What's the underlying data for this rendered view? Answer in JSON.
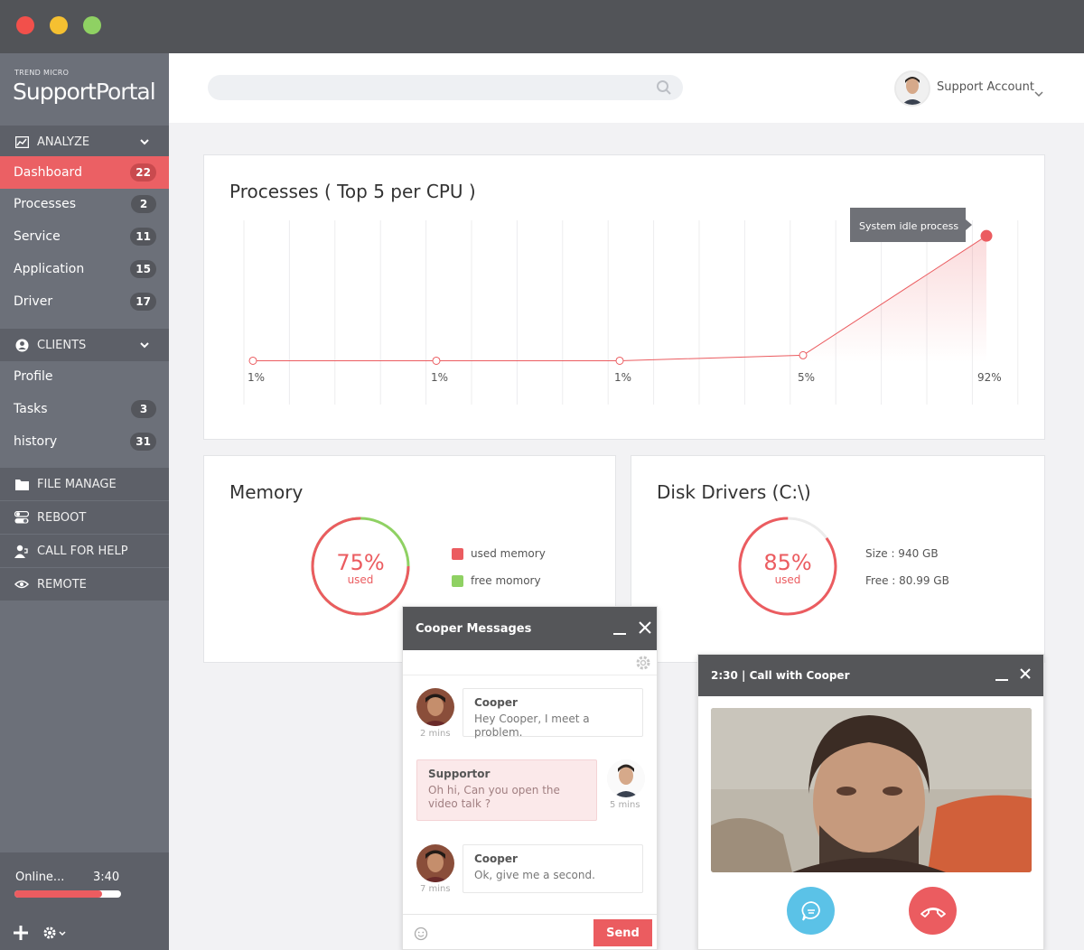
{
  "window": {
    "colors": {
      "close": "#f2504b",
      "minimize": "#f5c031",
      "zoom": "#8fd163"
    }
  },
  "brand": {
    "small": "TREND MICRO",
    "big_a": "Support",
    "big_b": "Portal"
  },
  "sidebar": {
    "analyze_label": "ANALYZE",
    "clients_label": "CLIENTS",
    "analyze_items": [
      {
        "label": "Dashboard",
        "count": "22"
      },
      {
        "label": "Processes",
        "count": "2"
      },
      {
        "label": "Service",
        "count": "11"
      },
      {
        "label": "Application",
        "count": "15"
      },
      {
        "label": "Driver",
        "count": "17"
      }
    ],
    "client_items": [
      {
        "label": "Profile",
        "count": ""
      },
      {
        "label": "Tasks",
        "count": "3"
      },
      {
        "label": "history",
        "count": "31"
      }
    ],
    "sections": [
      {
        "label": "FILE MANAGE",
        "icon": "folder-icon"
      },
      {
        "label": "REBOOT",
        "icon": "toggle-icon"
      },
      {
        "label": "CALL FOR HELP",
        "icon": "user-phone-icon"
      },
      {
        "label": "REMOTE",
        "icon": "eye-icon"
      }
    ],
    "status": {
      "label": "Online...",
      "time": "3:40",
      "progress": 0.82
    },
    "accent": "#eb6064"
  },
  "header": {
    "search_placeholder": "",
    "account_name": "Support Account"
  },
  "processes": {
    "title": "Processes ( Top 5 per CPU )",
    "tooltip": "System idle process"
  },
  "chart_data": {
    "type": "line",
    "title": "Processes ( Top 5 per CPU )",
    "categories": [
      "1%",
      "1%",
      "1%",
      "5%",
      "92%"
    ],
    "values": [
      1,
      1,
      1,
      5,
      92
    ],
    "ylim": [
      0,
      100
    ],
    "grid": "vertical",
    "annotation": "System idle process",
    "color": "#eb5c60"
  },
  "memory": {
    "title": "Memory",
    "percent": "75%",
    "used_fraction": 0.75,
    "sub": "used",
    "legend_used": "used memory",
    "legend_free": "free momory",
    "used_color": "#eb5c60",
    "free_color": "#8fd163"
  },
  "disk": {
    "title": "Disk Drivers (C:\\)",
    "percent": "85%",
    "used_fraction": 0.85,
    "sub": "used",
    "size": "Size : 940 GB",
    "free": "Free : 80.99 GB"
  },
  "messages": {
    "title": "Cooper Messages",
    "items": [
      {
        "name": "Cooper",
        "text": "Hey Cooper, I meet a problem.",
        "time": "2 mins"
      },
      {
        "name": "Supportor",
        "text": "Oh hi, Can you open the video talk ?",
        "time": "5 mins"
      },
      {
        "name": "Cooper",
        "text": "Ok, give me a second.",
        "time": "7 mins"
      }
    ],
    "send_label": "Send"
  },
  "call": {
    "title": "2:30 | Call with Cooper"
  }
}
